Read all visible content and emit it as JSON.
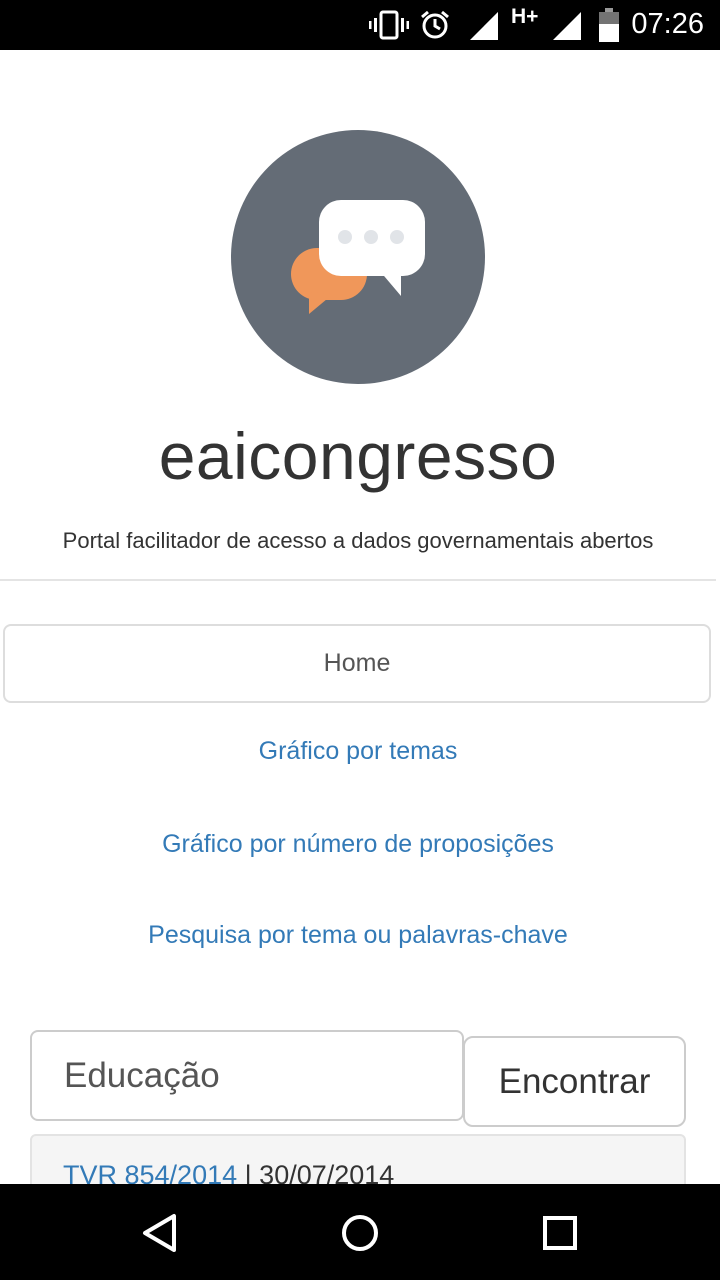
{
  "status_bar": {
    "time": "07:26",
    "network": "H+",
    "icons": [
      "vibrate-icon",
      "alarm-icon",
      "signal-icon",
      "signal-icon",
      "battery-icon"
    ]
  },
  "header": {
    "brand": "eaicongresso",
    "tagline": "Portal facilitador de acesso a dados governamentais abertos"
  },
  "nav": {
    "home": "Home",
    "links": [
      "Gráfico por temas",
      "Gráfico por número de proposições",
      "Pesquisa por tema ou palavras-chave"
    ]
  },
  "search": {
    "value": "Educação",
    "button": "Encontrar"
  },
  "results": [
    {
      "code": "TVR 854/2014",
      "separator": "|",
      "date": "30/07/2014"
    }
  ],
  "colors": {
    "link": "#337ab7",
    "logo_circle": "#646c76",
    "logo_orange_bubble": "#f0975a",
    "logo_white_bubble": "#ffffff"
  },
  "system_nav": [
    "back-icon",
    "home-icon",
    "recents-icon"
  ]
}
